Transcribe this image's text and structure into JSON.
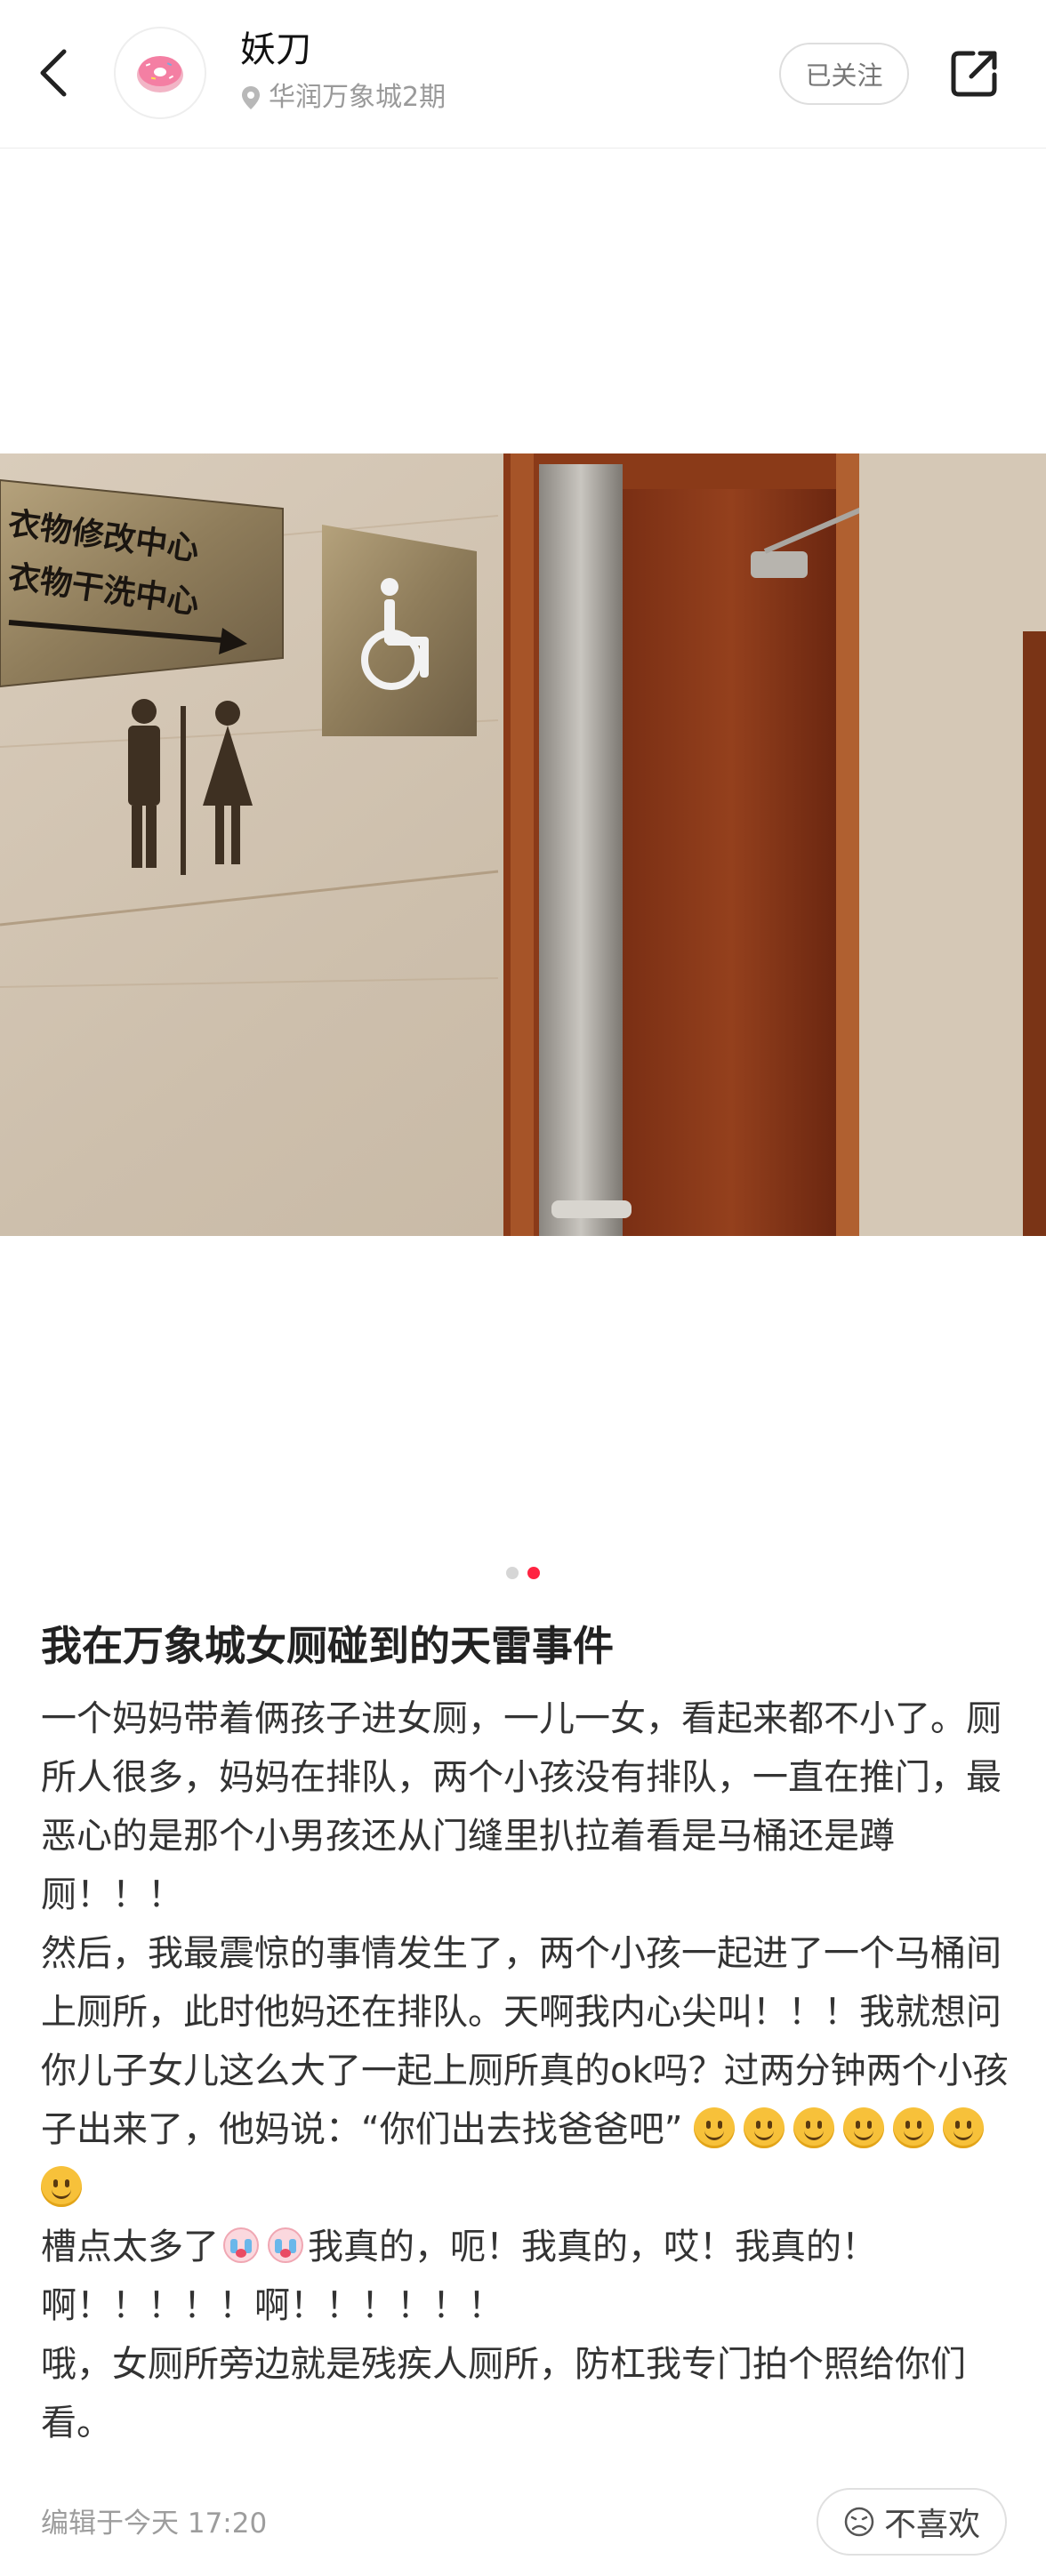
{
  "header": {
    "author_name": "妖刀",
    "location": "华润万象城2期",
    "follow_label": "已关注"
  },
  "photo": {
    "sign_line1": "衣物修改中心",
    "sign_line2": "衣物干洗中心",
    "pagination": {
      "current": 2,
      "total": 2
    }
  },
  "post": {
    "title": "我在万象城女厕碰到的天雷事件",
    "paragraphs": [
      "一个妈妈带着俩孩子进女厕，一儿一女，看起来都不小了。厕所人很多，妈妈在排队，两个小孩没有排队，一直在推门，最恶心的是那个小男孩还从门缝里扒拉着看是马桶还是蹲厕！！！",
      "然后，我最震惊的事情发生了，两个小孩一起进了一个马桶间上厕所，此时他妈还在排队。天啊我内心尖叫！！！我就想问你儿子女儿这么大了一起上厕所真的ok吗？过两分钟两个小孩子出来了，他妈说：“你们出去找爸爸吧”"
    ],
    "p3_start": "槽点太多了",
    "p3_rest": "我真的，呃！我真的，哎！我真的！啊！！！！！啊！！！！！！",
    "p4": "哦，女厕所旁边就是残疾人厕所，防杠我专门拍个照给你们看。",
    "smile_emoji_count": 7,
    "edit_time": "编辑于今天 17:20",
    "dislike_label": "不喜欢"
  },
  "colors": {
    "accent": "#ff2442",
    "muted": "#9d9d9d"
  }
}
